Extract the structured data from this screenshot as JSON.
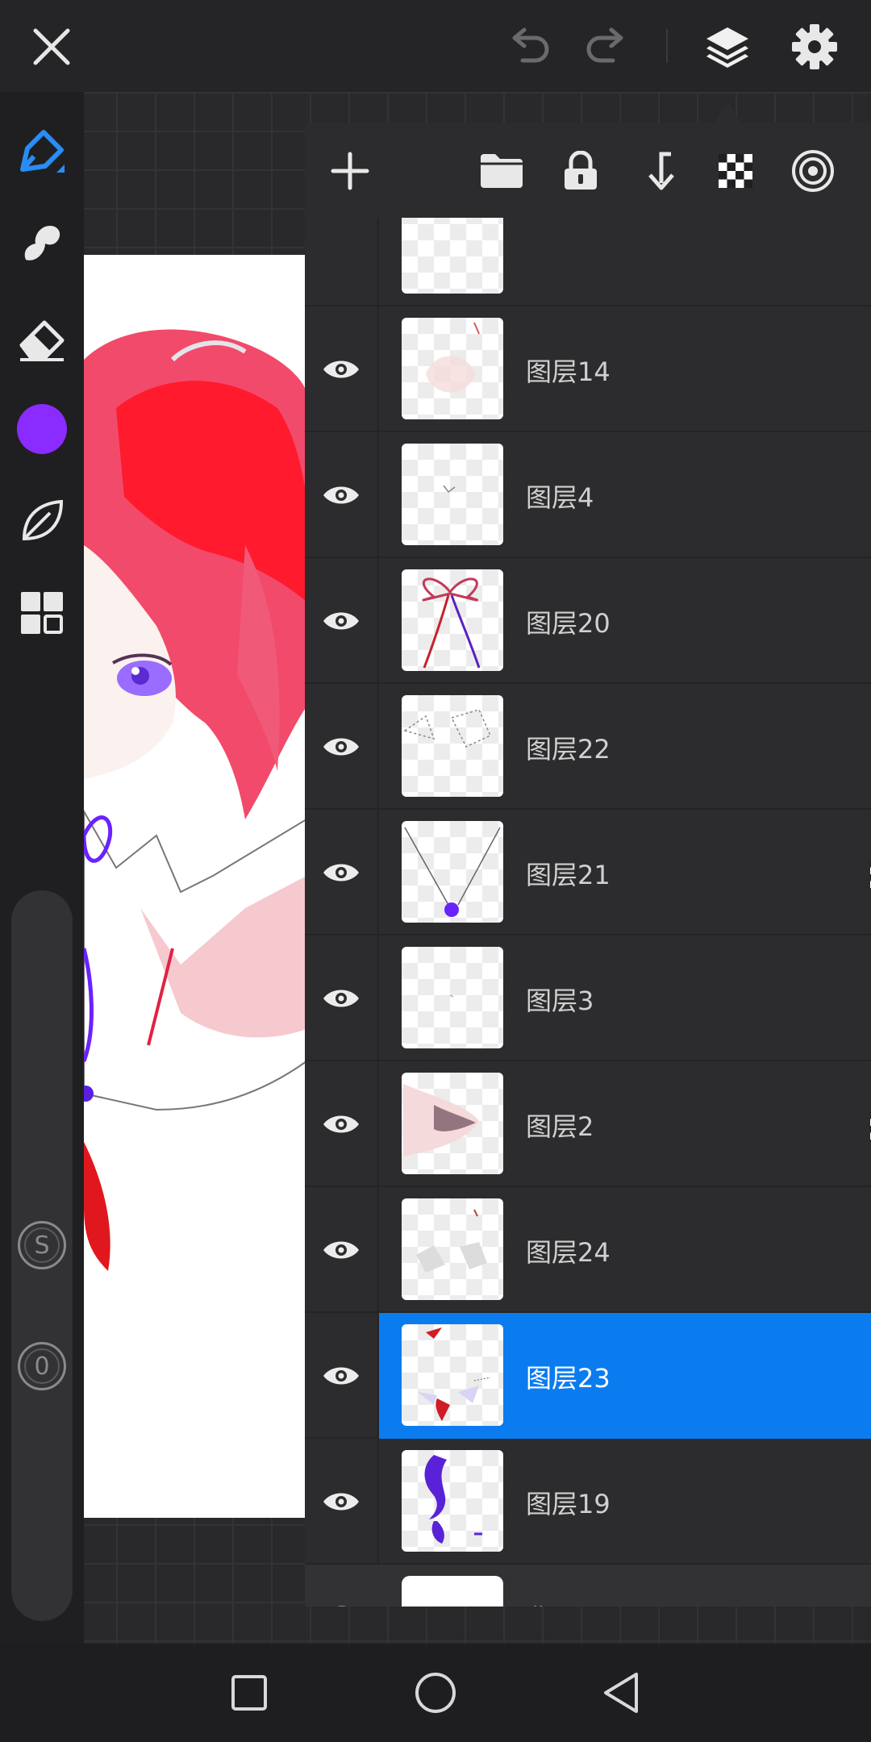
{
  "topbar": {
    "icons": [
      "close-icon",
      "undo-icon",
      "redo-icon",
      "layers-icon",
      "gear-icon"
    ]
  },
  "toolbar": {
    "tools": [
      "brush-pen-icon",
      "smudge-icon",
      "eraser-icon",
      "color-picker",
      "leaf-icon",
      "grid-icon"
    ],
    "current_color": "#8a2bff",
    "size_knob_label": "S",
    "opacity_knob_label": "0"
  },
  "layers_panel": {
    "header_icons": [
      "plus-icon",
      "folder-icon",
      "lock-icon",
      "merge-down-icon",
      "alpha-lock-icon",
      "blend-icon"
    ],
    "layers": [
      {
        "name": "",
        "visible": true,
        "selected": false,
        "clipped": false
      },
      {
        "name": "图层14",
        "visible": true,
        "selected": false,
        "clipped": false
      },
      {
        "name": "图层4",
        "visible": true,
        "selected": false,
        "clipped": false
      },
      {
        "name": "图层20",
        "visible": true,
        "selected": false,
        "clipped": false
      },
      {
        "name": "图层22",
        "visible": true,
        "selected": false,
        "clipped": false
      },
      {
        "name": "图层21",
        "visible": true,
        "selected": false,
        "clipped": true
      },
      {
        "name": "图层3",
        "visible": true,
        "selected": false,
        "clipped": false
      },
      {
        "name": "图层2",
        "visible": true,
        "selected": false,
        "clipped": true
      },
      {
        "name": "图层24",
        "visible": true,
        "selected": false,
        "clipped": false
      },
      {
        "name": "图层23",
        "visible": true,
        "selected": true,
        "clipped": false
      },
      {
        "name": "图层19",
        "visible": true,
        "selected": false,
        "clipped": false
      }
    ],
    "background_layer": {
      "name": "背景",
      "visible": true
    }
  },
  "colors": {
    "accent": "#0a7cf0",
    "panel_bg": "#2c2c2e",
    "toolbar_bg": "#1f1f21"
  },
  "navbar": {
    "icons": [
      "recent-apps-icon",
      "home-icon",
      "back-icon"
    ]
  }
}
